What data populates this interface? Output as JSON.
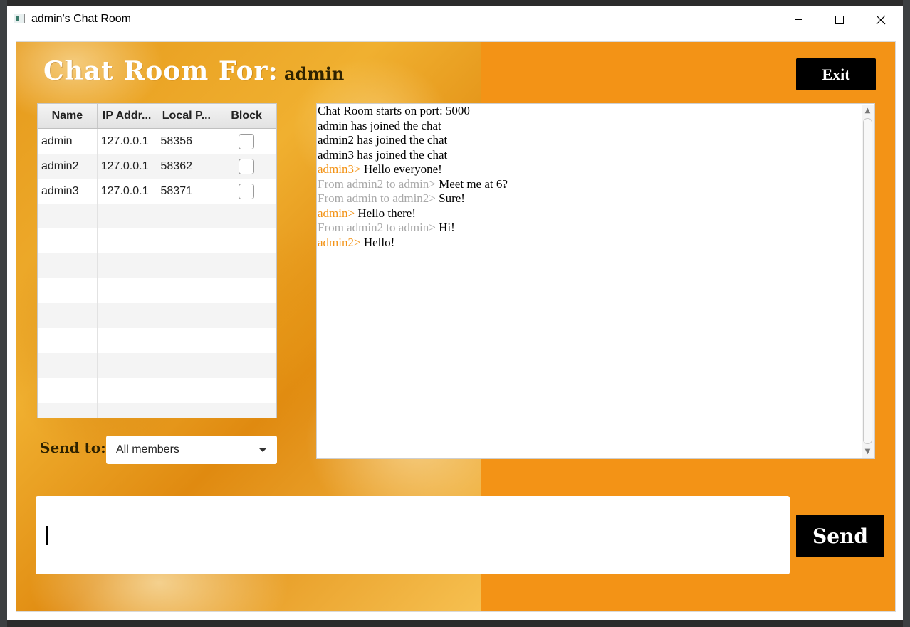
{
  "window": {
    "title": "admin's Chat Room"
  },
  "header": {
    "heading": "Chat Room For:",
    "username": "admin",
    "exit_label": "Exit"
  },
  "members_table": {
    "columns": [
      "Name",
      "IP Addr...",
      "Local P...",
      "Block"
    ],
    "rows": [
      {
        "name": "admin",
        "ip": "127.0.0.1",
        "port": "58356",
        "blocked": false
      },
      {
        "name": "admin2",
        "ip": "127.0.0.1",
        "port": "58362",
        "blocked": false
      },
      {
        "name": "admin3",
        "ip": "127.0.0.1",
        "port": "58371",
        "blocked": false
      }
    ]
  },
  "send_to": {
    "label": "Send to:",
    "selected": "All members"
  },
  "chat_log": [
    {
      "prefix": "",
      "prefix_style": "none",
      "text": "Chat Room starts on port: 5000"
    },
    {
      "prefix": "",
      "prefix_style": "none",
      "text": "admin has joined the chat"
    },
    {
      "prefix": "",
      "prefix_style": "none",
      "text": "admin2 has joined the chat"
    },
    {
      "prefix": "",
      "prefix_style": "none",
      "text": "admin3 has joined the chat"
    },
    {
      "prefix": "admin3> ",
      "prefix_style": "orange",
      "text": "Hello everyone!"
    },
    {
      "prefix": "From admin2 to admin> ",
      "prefix_style": "gray",
      "text": "Meet me at 6?"
    },
    {
      "prefix": "From admin to admin2> ",
      "prefix_style": "gray",
      "text": "Sure!"
    },
    {
      "prefix": "admin> ",
      "prefix_style": "orange",
      "text": "Hello there!"
    },
    {
      "prefix": "From admin2 to admin> ",
      "prefix_style": "gray",
      "text": "Hi!"
    },
    {
      "prefix": "admin2> ",
      "prefix_style": "orange",
      "text": "Hello!"
    }
  ],
  "message_input": {
    "value": ""
  },
  "send_label": "Send",
  "colors": {
    "accent": "#f39316",
    "system_prefix": "#a8a8a8",
    "button_bg": "#000000"
  }
}
